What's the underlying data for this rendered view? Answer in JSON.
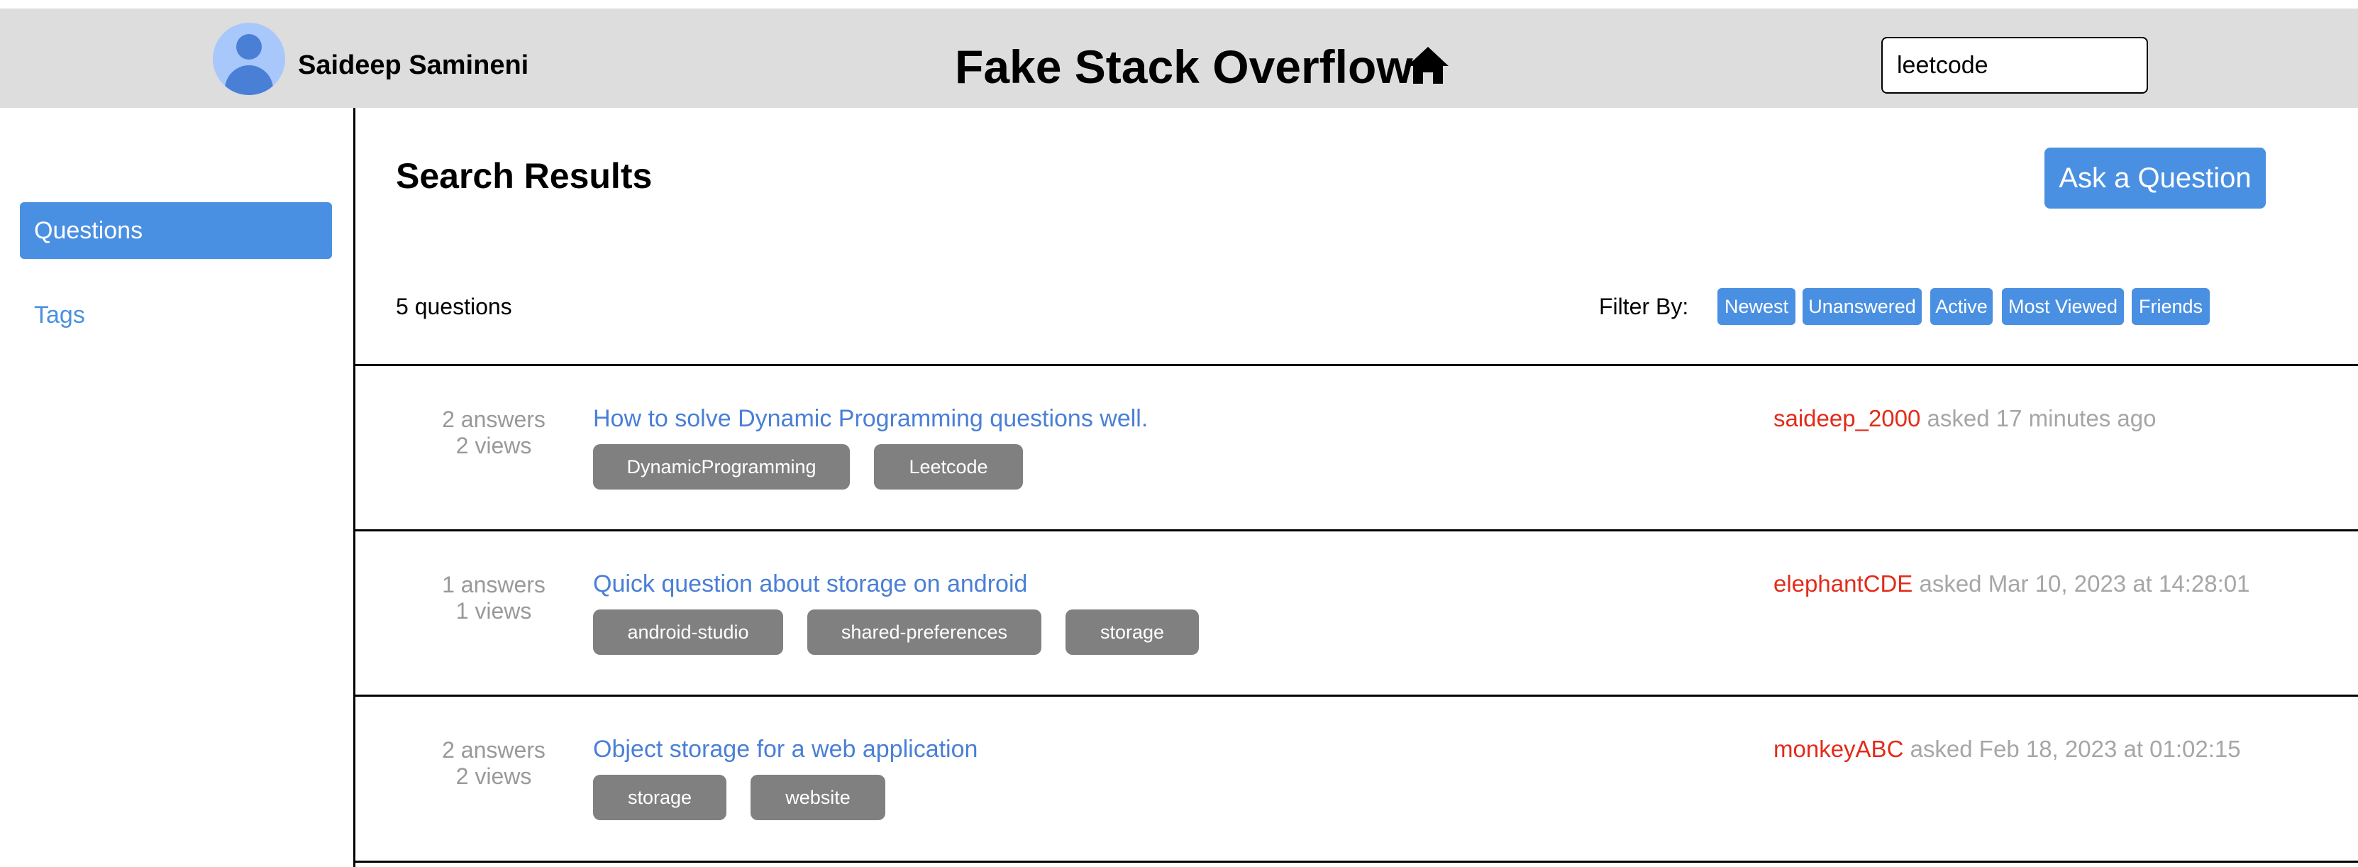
{
  "header": {
    "user_name": "Saideep Samineni",
    "app_title": "Fake Stack Overflow",
    "home_icon": "home-icon",
    "search_value": "leetcode"
  },
  "sidebar": {
    "items": [
      {
        "label": "Questions",
        "active": true
      },
      {
        "label": "Tags",
        "active": false
      }
    ]
  },
  "main": {
    "title": "Search Results",
    "ask_label": "Ask a Question",
    "count_label": "5 questions",
    "filter_label": "Filter By:",
    "filters": [
      "Newest",
      "Unanswered",
      "Active",
      "Most Viewed",
      "Friends"
    ]
  },
  "questions": [
    {
      "answers": "2 answers",
      "views": "2 views",
      "title": "How to solve Dynamic Programming questions well.",
      "tags": [
        "DynamicProgramming",
        "Leetcode"
      ],
      "user": "saideep_2000",
      "asked": "asked 17 minutes ago"
    },
    {
      "answers": "1 answers",
      "views": "1 views",
      "title": "Quick question about storage on android",
      "tags": [
        "android-studio",
        "shared-preferences",
        "storage"
      ],
      "user": "elephantCDE",
      "asked": "asked Mar 10, 2023 at 14:28:01"
    },
    {
      "answers": "2 answers",
      "views": "2 views",
      "title": "Object storage for a web application",
      "tags": [
        "storage",
        "website"
      ],
      "user": "monkeyABC",
      "asked": "asked Feb 18, 2023 at 01:02:15"
    }
  ],
  "colors": {
    "accent": "#4a90e2",
    "header_bg": "#dddddd",
    "tag_bg": "#808080",
    "username": "#e32b1a",
    "muted": "#999999"
  }
}
